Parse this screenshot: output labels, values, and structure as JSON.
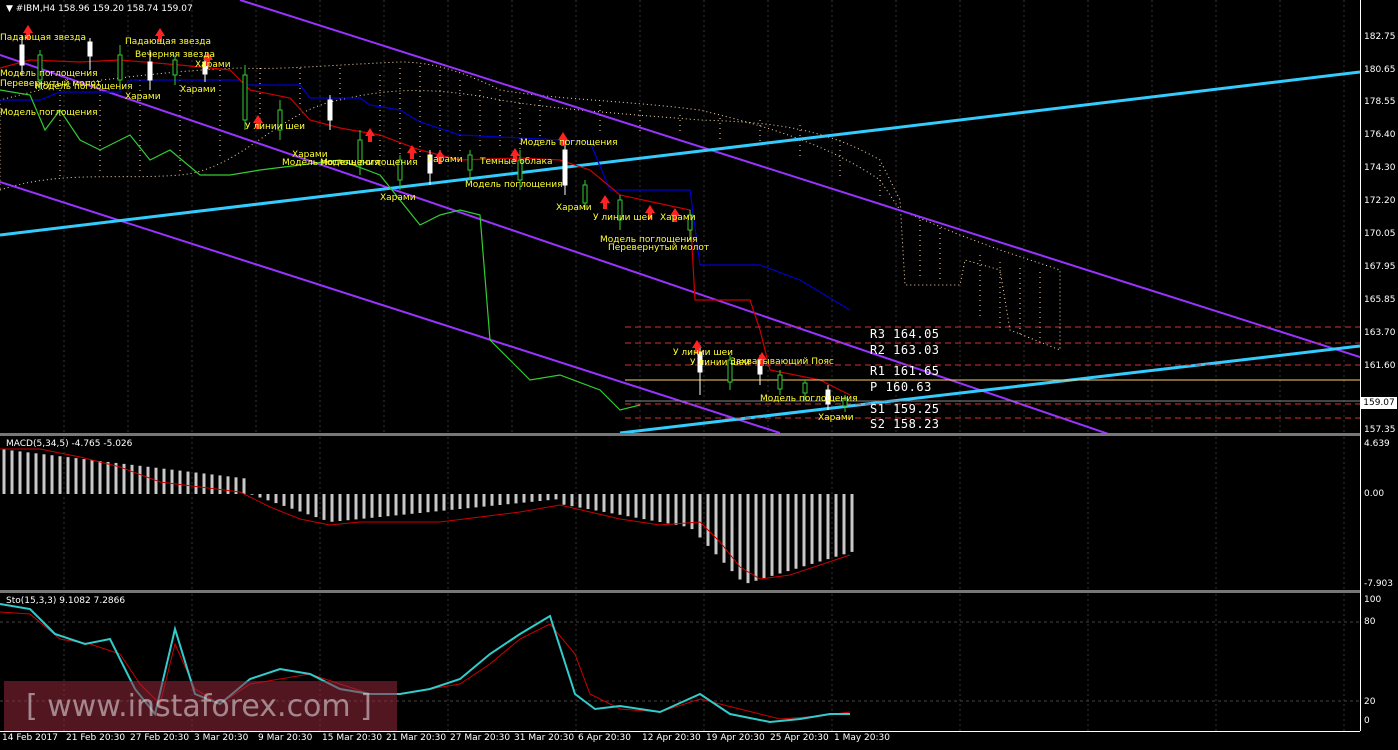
{
  "header": {
    "title": "#IBM,H4",
    "ohlc": "158.96 159.20 158.74 159.07",
    "menu_icon": "triangle-down-icon"
  },
  "price_axis": [
    "182.75",
    "180.65",
    "178.55",
    "176.40",
    "174.30",
    "172.20",
    "170.05",
    "167.95",
    "165.85",
    "163.70",
    "161.60",
    "159.07",
    "157.35"
  ],
  "current_price": "159.07",
  "pivots": {
    "r3": "R3 164.05",
    "r2": "R2 163.03",
    "r1": "R1 161.65",
    "p": "P 160.63",
    "s1": "S1 159.25",
    "s2": "S2 158.23"
  },
  "patterns": [
    "Падающая звезда",
    "Падающая звезда",
    "Вечерняя звезда",
    "Модель поглощения",
    "Перевернутый молот",
    "Модель поглощения",
    "Харами",
    "Харами",
    "Харами",
    "Модель поглощения",
    "У линии шеи",
    "Харами",
    "Харами",
    "Модель поглощения",
    "Модель поглощения",
    "Темные облака",
    "Харами",
    "Модель поглощения",
    "Модель поглощения",
    "Харами",
    "У линии шеи",
    "Модель поглощения",
    "Перевернутый молот",
    "У линии шеи",
    "Харами",
    "У линии шеи",
    "Захватывающий Пояс",
    "Модель поглощения",
    "Харами"
  ],
  "macd": {
    "label": "MACD(5,34,5) -4.765 -5.026",
    "axis": [
      "4.639",
      "0.00",
      "-7.903"
    ]
  },
  "stochastic": {
    "label": "Sto(15,3,3) 9.1082 7.2866",
    "axis": [
      "100",
      "80",
      "20",
      "0"
    ]
  },
  "time_axis": [
    "14 Feb 2017",
    "21 Feb 20:30",
    "27 Feb 20:30",
    "3 Mar 20:30",
    "9 Mar 20:30",
    "15 Mar 20:30",
    "21 Mar 20:30",
    "27 Mar 20:30",
    "31 Mar 20:30",
    "6 Apr 20:30",
    "12 Apr 20:30",
    "19 Apr 20:30",
    "25 Apr 20:30",
    "1 May 20:30"
  ],
  "watermark": "[ www.instaforex.com ]",
  "colors": {
    "channel": "#9933ff",
    "trendline": "#33ccff",
    "tenkan": "#cc0000",
    "kijun": "#0000cc",
    "chikou": "#33cc33",
    "macd_line": "#cc0000",
    "stoch_main": "#33cccc",
    "stoch_signal": "#cc0000",
    "bull_candle": "#ffffff",
    "bear_candle": "#33cc33"
  }
}
